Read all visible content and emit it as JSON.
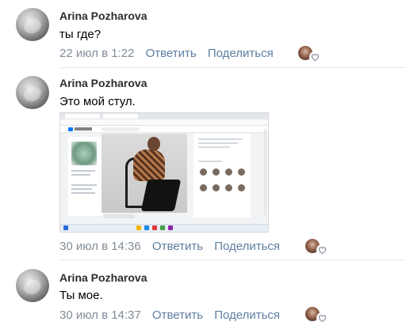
{
  "comments": [
    {
      "author": "Arina Pozharova",
      "text": "ты где?",
      "time": "22 июл в 1:22",
      "reply_label": "Ответить",
      "share_label": "Поделиться",
      "has_attachment": false
    },
    {
      "author": "Arina Pozharova",
      "text": "Это мой стул.",
      "time": "30 июл в 14:36",
      "reply_label": "Ответить",
      "share_label": "Поделиться",
      "has_attachment": true
    },
    {
      "author": "Arina Pozharova",
      "text": "Ты мое.",
      "time": "30 июл в 14:37",
      "reply_label": "Ответить",
      "share_label": "Поделиться",
      "has_attachment": false
    }
  ],
  "colors": {
    "link": "#5e7ea1",
    "meta": "#818c99",
    "divider": "#e7e8ec"
  }
}
